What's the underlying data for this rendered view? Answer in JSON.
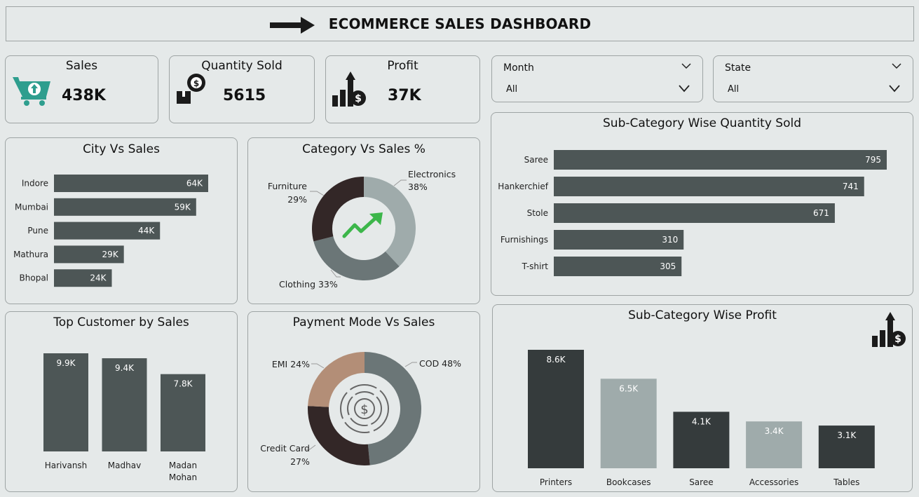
{
  "header": {
    "title": "ECOMMERCE SALES DASHBOARD"
  },
  "kpis": {
    "sales": {
      "label": "Sales",
      "value": "438K"
    },
    "quantity": {
      "label": "Quantity Sold",
      "value": "5615"
    },
    "profit": {
      "label": "Profit",
      "value": "37K"
    }
  },
  "slicers": {
    "month": {
      "label": "Month",
      "value": "All"
    },
    "state": {
      "label": "State",
      "value": "All"
    }
  },
  "colors": {
    "dark": "#4d5656",
    "darker": "#353b3c",
    "light": "#9fabab",
    "brown": "#332727",
    "mid": "#6b7677",
    "tan": "#b38e77",
    "green": "#2e9e8e",
    "up": "#3cb64a"
  },
  "chart_data": [
    {
      "id": "city",
      "type": "bar",
      "orientation": "horizontal",
      "title": "City Vs Sales",
      "categories": [
        "Indore",
        "Mumbai",
        "Pune",
        "Mathura",
        "Bhopal"
      ],
      "values": [
        64,
        59,
        44,
        29,
        24
      ],
      "labels": [
        "64K",
        "59K",
        "44K",
        "29K",
        "24K"
      ]
    },
    {
      "id": "category",
      "type": "pie",
      "title": "Category Vs Sales %",
      "categories": [
        "Electronics",
        "Clothing",
        "Furniture"
      ],
      "values": [
        38,
        33,
        29
      ],
      "labels": [
        "38%",
        "Clothing 33%",
        "29%"
      ]
    },
    {
      "id": "subcat_qty",
      "type": "bar",
      "orientation": "horizontal",
      "title": "Sub-Category Wise Quantity Sold",
      "categories": [
        "Saree",
        "Hankerchief",
        "Stole",
        "Furnishings",
        "T-shirt"
      ],
      "values": [
        795,
        741,
        671,
        310,
        305
      ],
      "labels": [
        "795",
        "741",
        "671",
        "310",
        "305"
      ]
    },
    {
      "id": "customer",
      "type": "bar",
      "title": "Top Customer by Sales",
      "categories": [
        "Harivansh",
        "Madhav",
        "Madan Mohan"
      ],
      "values": [
        9.9,
        9.4,
        7.8
      ],
      "labels": [
        "9.9K",
        "9.4K",
        "7.8K"
      ]
    },
    {
      "id": "payment",
      "type": "pie",
      "title": "Payment Mode Vs Sales",
      "categories": [
        "COD",
        "Credit Card",
        "EMI"
      ],
      "values": [
        48,
        27,
        24
      ],
      "labels": [
        "COD 48%",
        "Credit Card",
        "EMI 24%"
      ],
      "sublabels": [
        "",
        "27%",
        ""
      ]
    },
    {
      "id": "subcat_profit",
      "type": "bar",
      "title": "Sub-Category Wise Profit",
      "categories": [
        "Printers",
        "Bookcases",
        "Saree",
        "Accessories",
        "Tables"
      ],
      "values": [
        8.6,
        6.5,
        4.1,
        3.4,
        3.1
      ],
      "labels": [
        "8.6K",
        "6.5K",
        "4.1K",
        "3.4K",
        "3.1K"
      ]
    }
  ]
}
